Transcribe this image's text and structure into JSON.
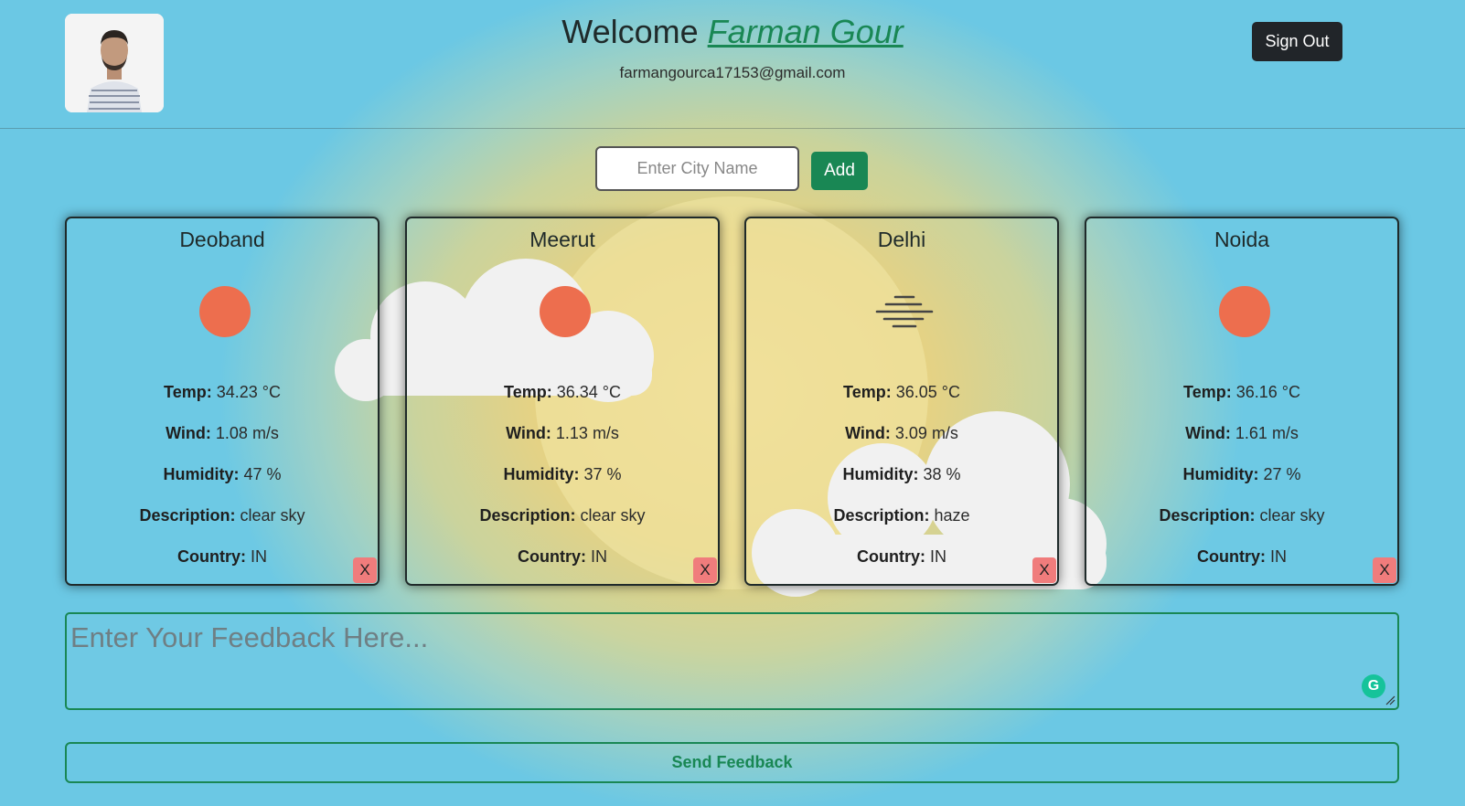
{
  "header": {
    "welcome_prefix": "Welcome",
    "user_name": "Farman Gour",
    "email": "farmangourca17153@gmail.com",
    "sign_out_label": "Sign Out"
  },
  "search": {
    "placeholder": "Enter City Name",
    "add_label": "Add"
  },
  "labels": {
    "temp": "Temp:",
    "wind": "Wind:",
    "humidity": "Humidity:",
    "description": "Description:",
    "country": "Country:",
    "delete": "X"
  },
  "cards": [
    {
      "city": "Deoband",
      "icon": "sun-icon",
      "temp": "34.23 °C",
      "wind": "1.08 m/s",
      "humidity": "47 %",
      "description": "clear sky",
      "country": "IN"
    },
    {
      "city": "Meerut",
      "icon": "sun-icon",
      "temp": "36.34 °C",
      "wind": "1.13 m/s",
      "humidity": "37 %",
      "description": "clear sky",
      "country": "IN"
    },
    {
      "city": "Delhi",
      "icon": "haze-icon",
      "temp": "36.05 °C",
      "wind": "3.09 m/s",
      "humidity": "38 %",
      "description": "haze",
      "country": "IN"
    },
    {
      "city": "Noida",
      "icon": "sun-icon",
      "temp": "36.16 °C",
      "wind": "1.61 m/s",
      "humidity": "27 %",
      "description": "clear sky",
      "country": "IN"
    }
  ],
  "feedback": {
    "placeholder": "Enter Your Feedback Here...",
    "send_label": "Send Feedback"
  },
  "colors": {
    "accent": "#198754",
    "sun": "#ed6e4e",
    "delete": "#f07c7c",
    "dark": "#212529"
  }
}
